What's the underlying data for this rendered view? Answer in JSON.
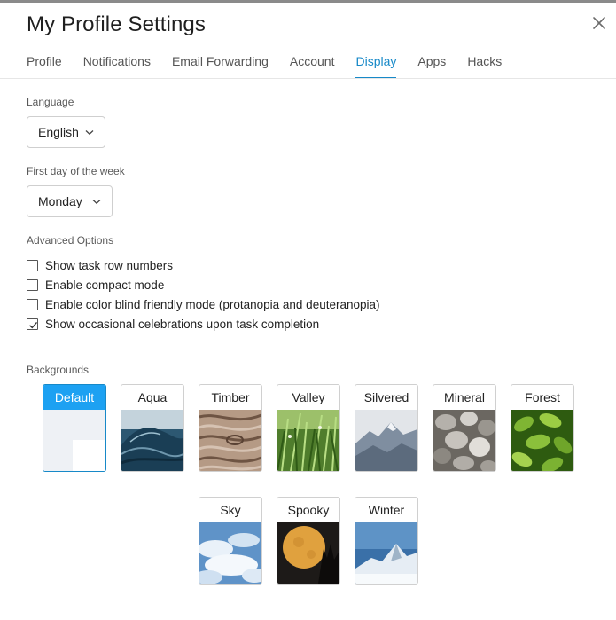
{
  "header": {
    "title": "My Profile Settings"
  },
  "tabs": [
    {
      "label": "Profile"
    },
    {
      "label": "Notifications"
    },
    {
      "label": "Email Forwarding"
    },
    {
      "label": "Account"
    },
    {
      "label": "Display"
    },
    {
      "label": "Apps"
    },
    {
      "label": "Hacks"
    }
  ],
  "active_tab": "Display",
  "language": {
    "label": "Language",
    "value": "English"
  },
  "first_day": {
    "label": "First day of the week",
    "value": "Monday"
  },
  "advanced": {
    "label": "Advanced Options",
    "options": [
      {
        "label": "Show task row numbers",
        "checked": false
      },
      {
        "label": "Enable compact mode",
        "checked": false
      },
      {
        "label": "Enable color blind friendly mode (protanopia and deuteranopia)",
        "checked": false
      },
      {
        "label": "Show occasional celebrations upon task completion",
        "checked": true
      }
    ]
  },
  "backgrounds": {
    "label": "Backgrounds",
    "selected": "Default",
    "items": [
      {
        "name": "Default"
      },
      {
        "name": "Aqua"
      },
      {
        "name": "Timber"
      },
      {
        "name": "Valley"
      },
      {
        "name": "Silvered"
      },
      {
        "name": "Mineral"
      },
      {
        "name": "Forest"
      },
      {
        "name": "Sky"
      },
      {
        "name": "Spooky"
      },
      {
        "name": "Winter"
      }
    ]
  },
  "colors": {
    "accent": "#1789c8",
    "selected_tile_header": "#1da1f2"
  }
}
